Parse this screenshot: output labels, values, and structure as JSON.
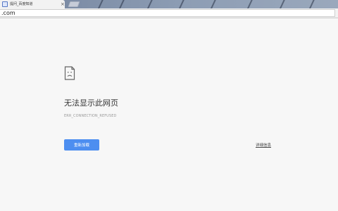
{
  "tab": {
    "title": "提问_百度知道",
    "favicon": "baidu-favicon-icon",
    "close_glyph": "×"
  },
  "address_bar": {
    "url": ".com"
  },
  "error": {
    "icon": "sad-page-icon",
    "heading": "无法显示此网页",
    "code": "ERR_CONNECTION_REFUSED",
    "reload_label": "重新加载",
    "details_label": "详细信息"
  },
  "colors": {
    "button_blue": "#4d8ef0",
    "page_background": "#f7f7f7"
  }
}
